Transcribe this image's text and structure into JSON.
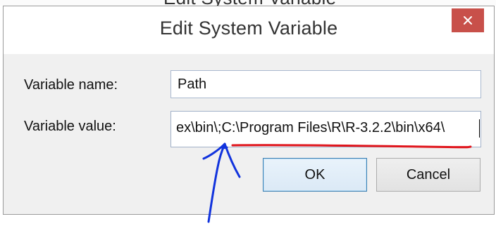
{
  "window": {
    "partial_above_text": "Edit System Variable",
    "title": "Edit System Variable",
    "close_symbol": "×"
  },
  "form": {
    "name_label": "Variable name:",
    "name_value": "Path",
    "value_label": "Variable value:",
    "value_value": "ex\\bin\\;C:\\Program Files\\R\\R-3.2.2\\bin\\x64\\"
  },
  "buttons": {
    "ok_label": "OK",
    "cancel_label": "Cancel"
  },
  "colors": {
    "close_button": "#c8504a",
    "annotation_underline": "#e0141b",
    "annotation_arrow": "#1133dd"
  },
  "icons": {
    "close": "close-icon"
  },
  "annotations": {
    "underline": "red hand-drawn underline",
    "arrow": "blue hand-drawn arrow"
  }
}
